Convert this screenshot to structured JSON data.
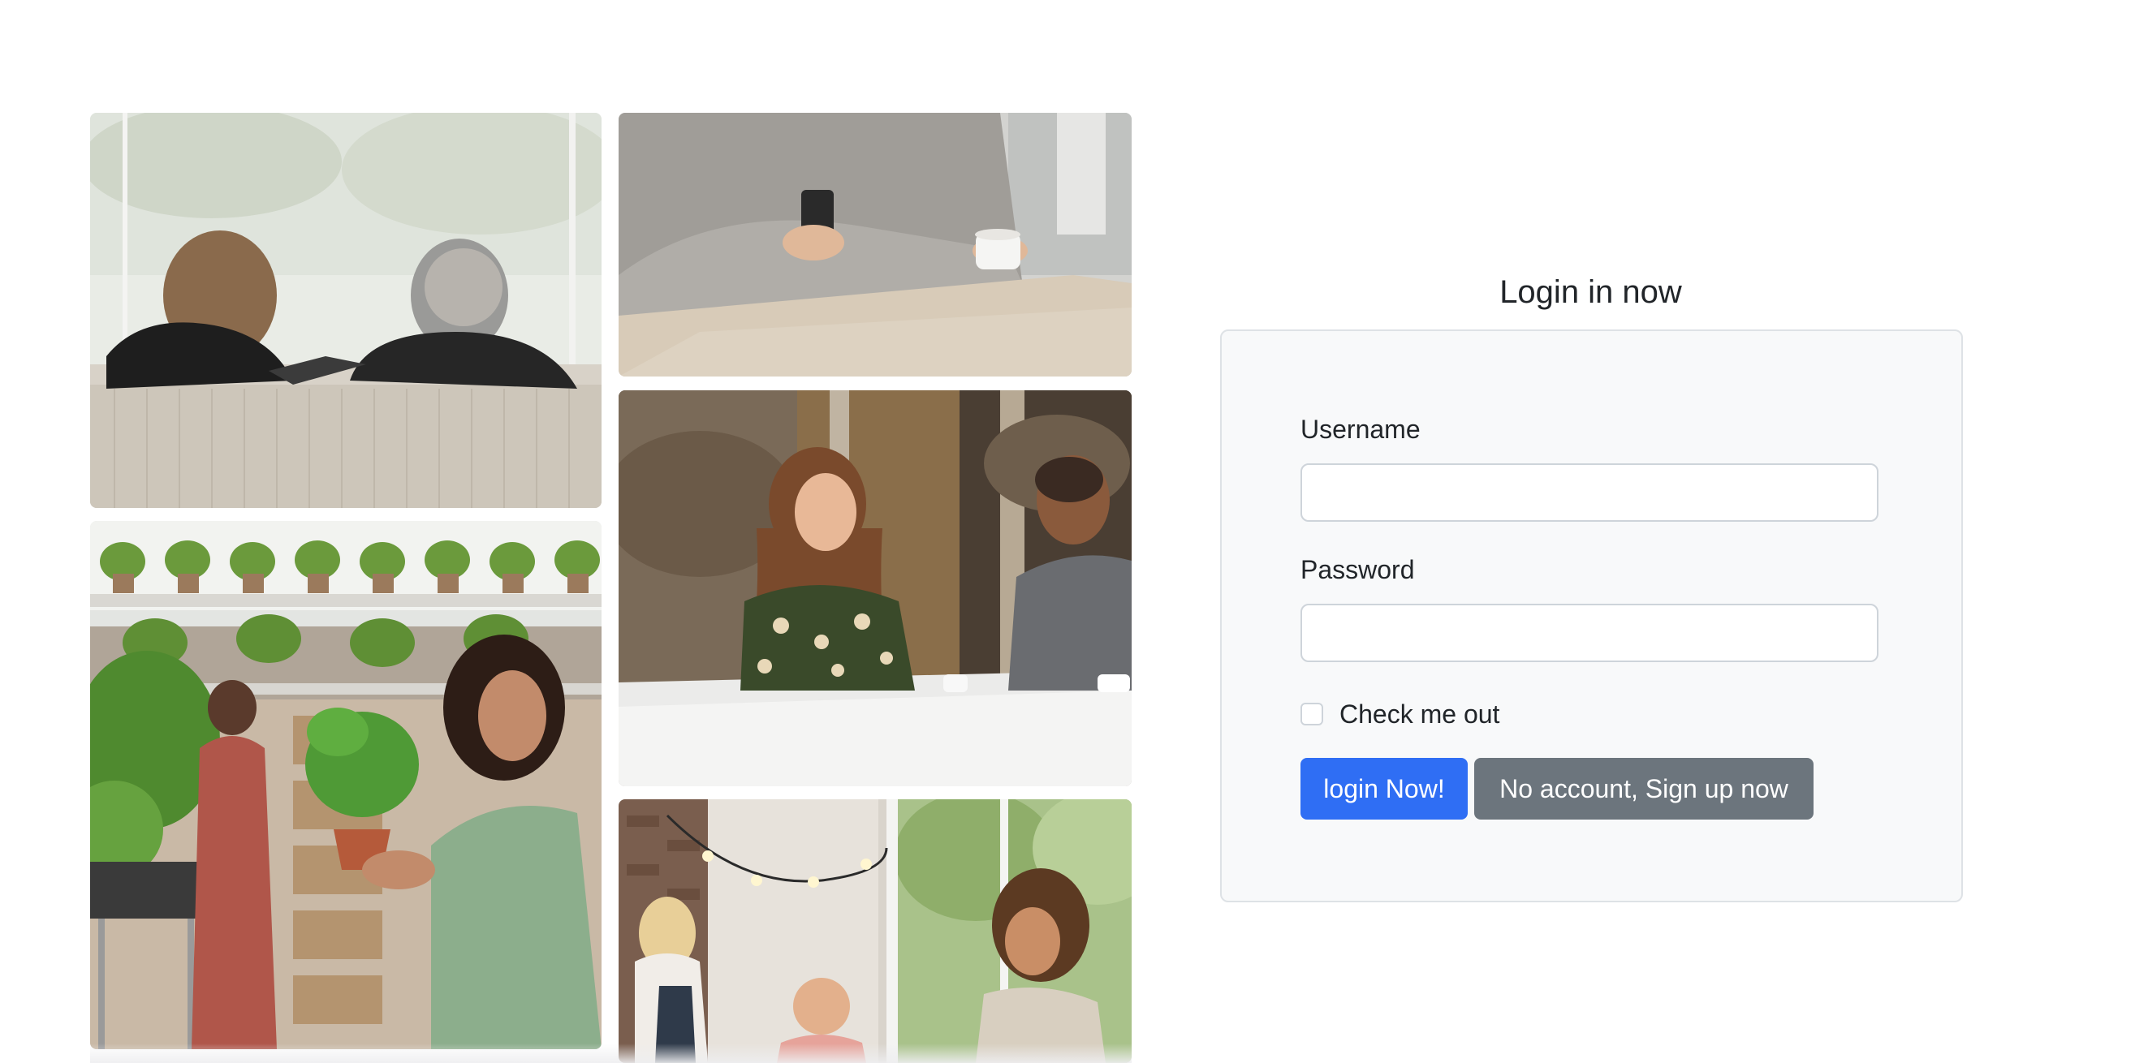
{
  "gallery": {
    "photos": [
      {
        "name": "couple-on-sofa"
      },
      {
        "name": "woman-holding-plant"
      },
      {
        "name": "person-with-phone-and-cup"
      },
      {
        "name": "two-people-chatting-at-table"
      },
      {
        "name": "people-hanging-lights"
      }
    ]
  },
  "login": {
    "title": "Login in now",
    "username_label": "Username",
    "username_value": "",
    "password_label": "Password",
    "password_value": "",
    "checkbox_label": "Check me out",
    "checkbox_checked": false,
    "login_button": "login Now!",
    "signup_button": "No account, Sign up now"
  },
  "colors": {
    "primary": "#2f6ef4",
    "secondary": "#6c757d",
    "card_background": "#f8f9fa",
    "card_border": "#dee2e6"
  }
}
